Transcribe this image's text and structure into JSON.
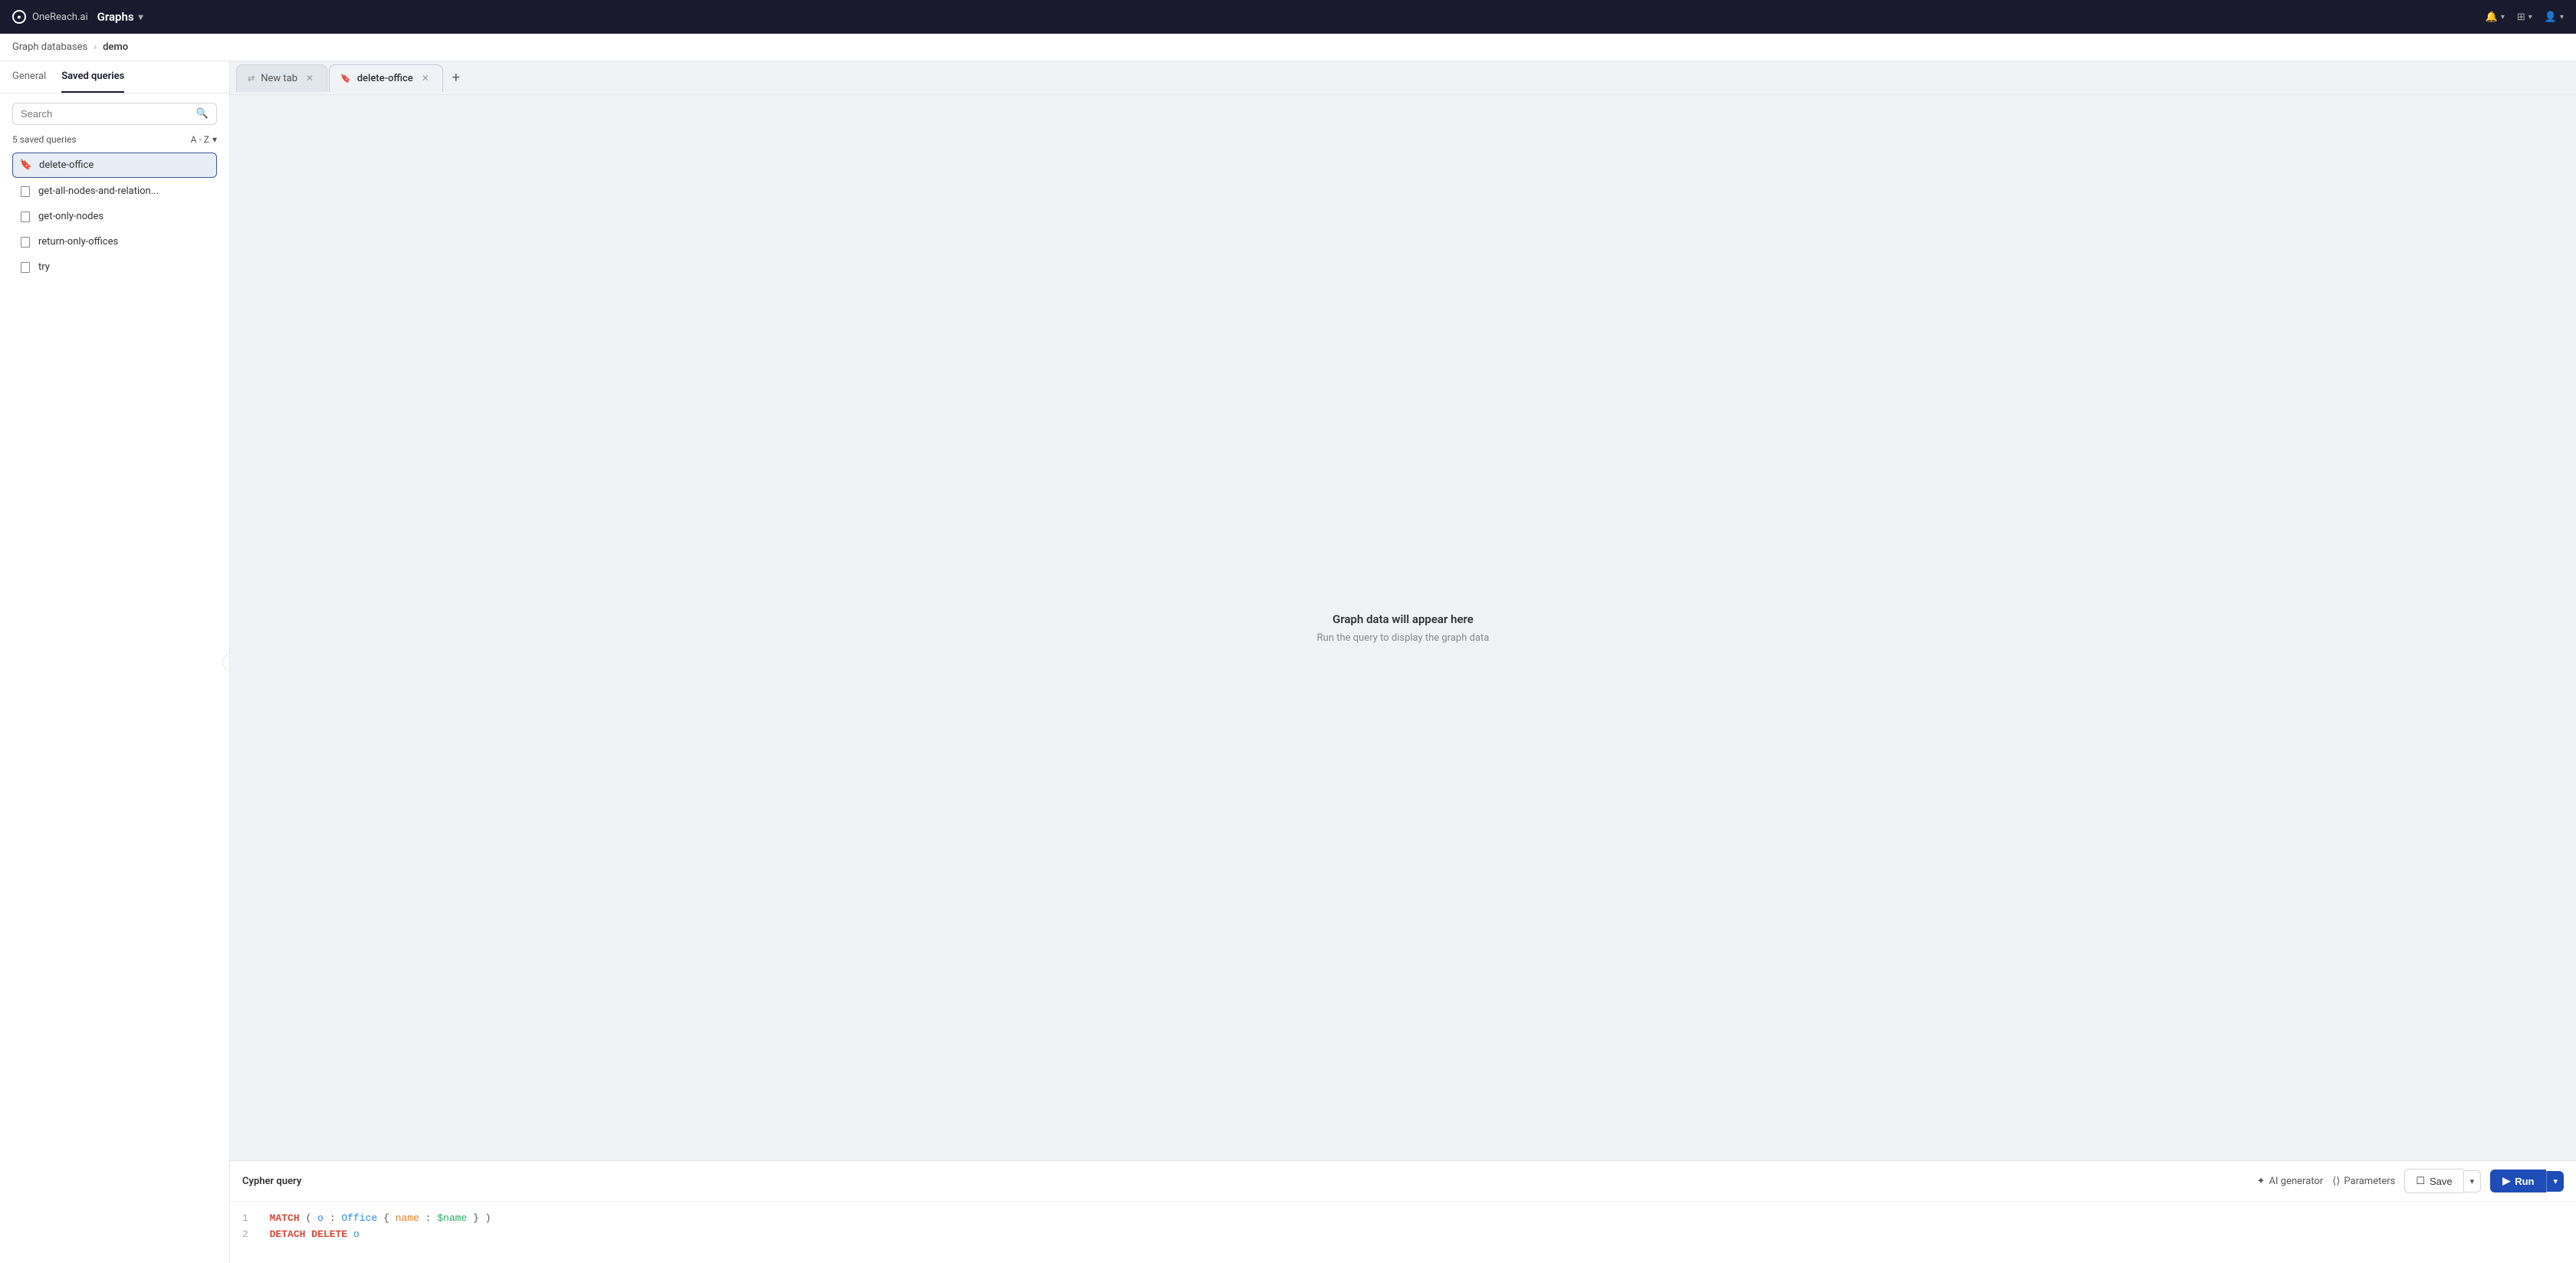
{
  "topnav": {
    "logo_text": "OneReach.ai",
    "title": "Graphs",
    "dropdown_icon": "▾",
    "bell_label": "Notifications",
    "grid_label": "Apps",
    "user_label": "User"
  },
  "breadcrumb": {
    "parent": "Graph databases",
    "separator": "›",
    "current": "demo"
  },
  "sidebar": {
    "tabs": [
      {
        "label": "General",
        "active": false
      },
      {
        "label": "Saved queries",
        "active": true
      }
    ],
    "search_placeholder": "Search",
    "queries_count": "5 saved queries",
    "sort_label": "A - Z",
    "queries": [
      {
        "label": "delete-office",
        "active": true,
        "icon": "bookmark"
      },
      {
        "label": "get-all-nodes-and-relation...",
        "active": false,
        "icon": "doc"
      },
      {
        "label": "get-only-nodes",
        "active": false,
        "icon": "doc"
      },
      {
        "label": "return-only-offices",
        "active": false,
        "icon": "doc"
      },
      {
        "label": "try",
        "active": false,
        "icon": "doc"
      }
    ],
    "collapse_icon": "‹"
  },
  "tabs": [
    {
      "label": "New tab",
      "active": false,
      "closable": true,
      "icon": "share"
    },
    {
      "label": "delete-office",
      "active": true,
      "closable": true,
      "icon": "bookmark"
    }
  ],
  "add_tab_label": "+",
  "graph_area": {
    "placeholder_title": "Graph data will appear here",
    "placeholder_subtitle": "Run the query to display the graph data"
  },
  "cypher": {
    "title": "Cypher query",
    "ai_generator_label": "AI generator",
    "parameters_label": "Parameters",
    "save_label": "Save",
    "run_label": "Run",
    "lines": [
      {
        "num": "1",
        "content": "MATCH (o:Office {name: $name})"
      },
      {
        "num": "2",
        "content": "DETACH DELETE o"
      }
    ]
  }
}
